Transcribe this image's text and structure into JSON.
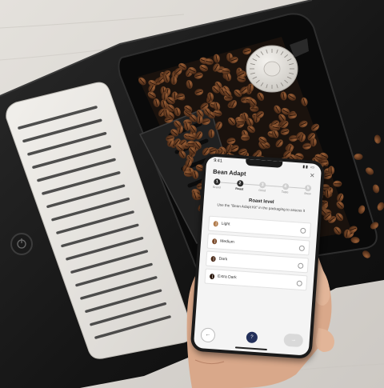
{
  "app": {
    "title": "Bean Adapt",
    "close_icon": "close-icon",
    "status_time": "9:41"
  },
  "stepper": {
    "steps": [
      {
        "number": "1",
        "label": "Brand",
        "state": "done"
      },
      {
        "number": "2",
        "label": "Roast",
        "state": "active"
      },
      {
        "number": "3",
        "label": "Grind",
        "state": "pending"
      },
      {
        "number": "4",
        "label": "Taste",
        "state": "pending"
      },
      {
        "number": "5",
        "label": "Brew",
        "state": "pending"
      }
    ]
  },
  "roast": {
    "section_title": "Roast level",
    "instruction": "Use the \"Bean Adapt Kit\" in the packaging to assess it",
    "options": [
      {
        "label": "Light",
        "bean_color": "#b07a4a"
      },
      {
        "label": "Medium",
        "bean_color": "#7a4a2a"
      },
      {
        "label": "Dark",
        "bean_color": "#4a2a18"
      },
      {
        "label": "Extra Dark",
        "bean_color": "#2a170d"
      }
    ]
  },
  "footer": {
    "back_label": "←",
    "help_label": "?",
    "next_label": "→"
  },
  "colors": {
    "accent": "#23305a",
    "machine_body": "#1c1c1c",
    "drip_tray": "#e6e3de",
    "countertop": "#d9d6d2"
  }
}
